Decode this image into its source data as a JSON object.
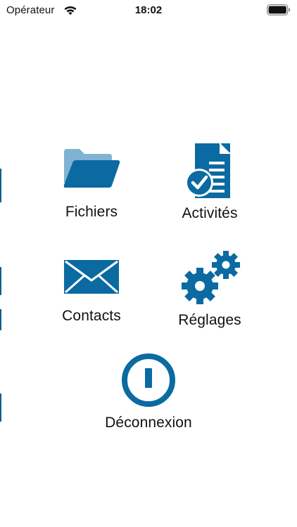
{
  "status_bar": {
    "carrier": "Opérateur",
    "time": "18:02",
    "wifi_icon": "wifi-icon",
    "battery_icon": "battery-full-icon"
  },
  "colors": {
    "primary": "#0b6aa2",
    "primary_light": "#7fb2d3",
    "background": "#ffffff",
    "text": "#111111"
  },
  "menu": {
    "fichiers": {
      "label": "Fichiers",
      "icon": "folder-icon"
    },
    "activites": {
      "label": "Activités",
      "icon": "checklist-document-icon"
    },
    "contacts": {
      "label": "Contacts",
      "icon": "envelope-icon"
    },
    "reglages": {
      "label": "Réglages",
      "icon": "gears-icon"
    },
    "deconnexion": {
      "label": "Déconnexion",
      "icon": "power-icon"
    }
  }
}
